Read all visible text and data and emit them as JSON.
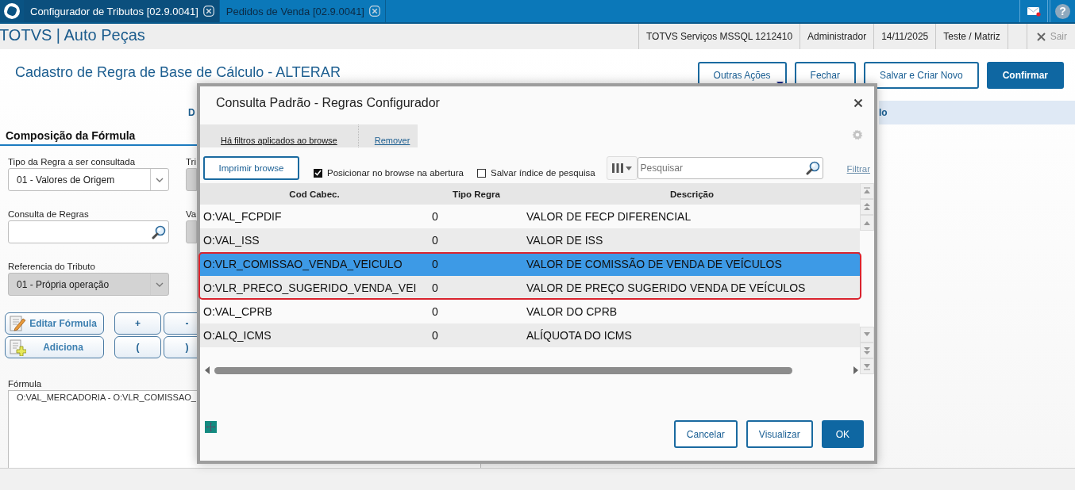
{
  "top_bar": {
    "tabs": [
      {
        "label": "Configurador de Tributos [02.9.0041]",
        "selected": true
      },
      {
        "label": "Pedidos de Venda [02.9.0041]",
        "selected": false
      }
    ],
    "help": "?"
  },
  "header": {
    "company": "TOTVS | Auto Peças",
    "info": [
      "TOTVS Serviços MSSQL 1212410",
      "Administrador",
      "14/11/2025",
      "Teste / Matriz"
    ],
    "exit": {
      "label": "Sair",
      "disabled": true
    }
  },
  "page": {
    "title": "Cadastro de Regra de Base de Cálculo - ALTERAR",
    "actions": [
      {
        "label": "Outras Ações",
        "kind": "menu"
      },
      {
        "label": "Fechar",
        "kind": "outline"
      },
      {
        "label": "Salvar e Criar Novo",
        "kind": "outline"
      },
      {
        "label": "Confirmar",
        "kind": "primary"
      }
    ],
    "folder_tabs": [
      "D",
      "lo"
    ],
    "section": "Composição da Fórmula",
    "fields": [
      {
        "label": "Tipo da Regra a ser consultada",
        "kind": "select",
        "value": "01 - Valores de Origem",
        "disabled": false
      },
      {
        "label": "Tri",
        "kind": "text",
        "disabled": true
      },
      {
        "label": "Consulta de Regras",
        "kind": "search",
        "disabled": false
      },
      {
        "label": "Va",
        "kind": "text",
        "disabled": true
      },
      {
        "label": "Referencia do Tributo",
        "kind": "select",
        "value": "01 - Própria operação",
        "disabled": true
      }
    ],
    "tool_buttons": [
      {
        "label": "Editar Fórmula",
        "kind": "edit"
      },
      {
        "label": "+",
        "kind": "operator"
      },
      {
        "label": "-",
        "kind": "operator"
      },
      {
        "label": "Adiciona",
        "kind": "add"
      },
      {
        "label": "(",
        "kind": "operator"
      },
      {
        "label": ")",
        "kind": "operator"
      }
    ],
    "formula": {
      "label": "Fórmula",
      "value": "O:VAL_MERCADORIA - O:VLR_COMISSAO_"
    }
  },
  "dialog": {
    "title": "Consulta Padrão - Regras Configurador",
    "filter_notice": "Há filtros aplicados ao browse",
    "remove_link": "Remover",
    "print_button": "Imprimir browse",
    "options": [
      {
        "label": "Posicionar no browse na abertura",
        "checked": true
      },
      {
        "label": "Salvar índice de pesquisa",
        "checked": false
      }
    ],
    "search": {
      "placeholder": "Pesquisar"
    },
    "filter_link": "Filtrar",
    "table": {
      "columns": [
        "Cod Cabec.",
        "Tipo Regra",
        "Descrição"
      ],
      "rows": [
        {
          "cells": [
            "O:VAL_FCPDIF",
            "0",
            "VALOR DE FECP DIFERENCIAL"
          ],
          "selected": false,
          "marked": false
        },
        {
          "cells": [
            "O:VAL_ISS",
            "0",
            "VALOR DE ISS"
          ],
          "selected": false,
          "marked": false
        },
        {
          "cells": [
            "O:VLR_COMISSAO_VENDA_VEICULO",
            "0",
            "VALOR DE COMISSÃO DE VENDA DE VEÍCULOS"
          ],
          "selected": true,
          "marked": true
        },
        {
          "cells": [
            "O:VLR_PRECO_SUGERIDO_VENDA_VEI",
            "0",
            "VALOR DE PREÇO SUGERIDO VENDA DE VEÍCULOS"
          ],
          "selected": false,
          "marked": true
        },
        {
          "cells": [
            "O:VAL_CPRB",
            "0",
            "VALOR DO CPRB"
          ],
          "selected": false,
          "marked": false
        },
        {
          "cells": [
            "O:ALQ_ICMS",
            "0",
            "ALÍQUOTA DO ICMS"
          ],
          "selected": false,
          "marked": false
        }
      ]
    },
    "buttons": [
      {
        "label": "Cancelar",
        "kind": "outline"
      },
      {
        "label": "Visualizar",
        "kind": "outline"
      },
      {
        "label": "OK",
        "kind": "primary"
      }
    ]
  }
}
